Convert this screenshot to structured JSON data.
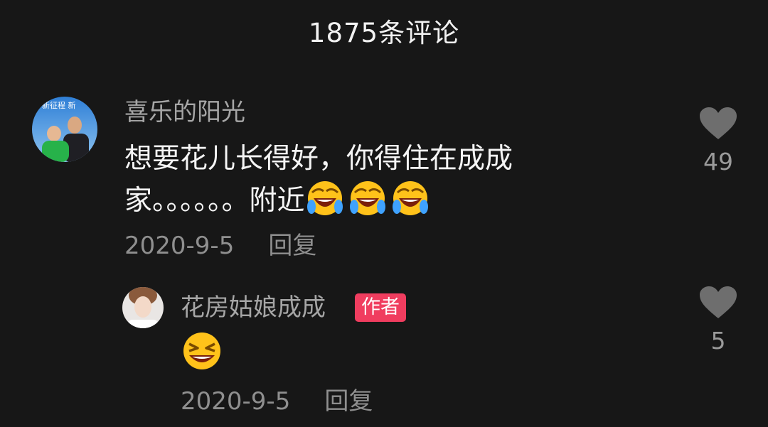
{
  "header": {
    "title": "1875条评论"
  },
  "comments": [
    {
      "username": "喜乐的阳光",
      "avatar_text": "新征程 新",
      "text_line1": "想要花儿长得好，你得住在成成",
      "text_line2": "家。。。。。。附近",
      "emojis": [
        "laughing-crying-emoji",
        "laughing-crying-emoji",
        "laughing-crying-emoji"
      ],
      "date": "2020-9-5",
      "reply_label": "回复",
      "like_count": "49",
      "reply": {
        "username": "花房姑娘成成",
        "badge": "作者",
        "emoji": "grinning-squint-emoji",
        "date": "2020-9-5",
        "reply_label": "回复",
        "like_count": "5"
      }
    }
  ],
  "colors": {
    "background": "#171717",
    "badge": "#f03d5f",
    "username": "#a6a6a6",
    "meta": "#8f8f8f",
    "heart": "#6e6e6e"
  }
}
